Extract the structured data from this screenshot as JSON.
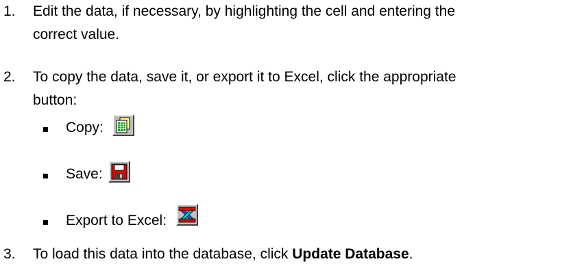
{
  "steps": [
    {
      "number": "1.",
      "line1": "Edit the data, if necessary, by highlighting the cell and entering the",
      "line2": "correct value."
    },
    {
      "number": "2.",
      "line1": "To copy the data, save it, or export it to Excel, click the appropriate",
      "line2": "button:"
    },
    {
      "number": "3.",
      "text_before": "To load this data into the database, click ",
      "bold": "Update Database",
      "text_after": "."
    }
  ],
  "buttons": [
    {
      "label": "Copy:",
      "icon": "copy-icon"
    },
    {
      "label": "Save:",
      "icon": "save-icon"
    },
    {
      "label": "Export to Excel:",
      "icon": "excel-export-icon"
    }
  ]
}
